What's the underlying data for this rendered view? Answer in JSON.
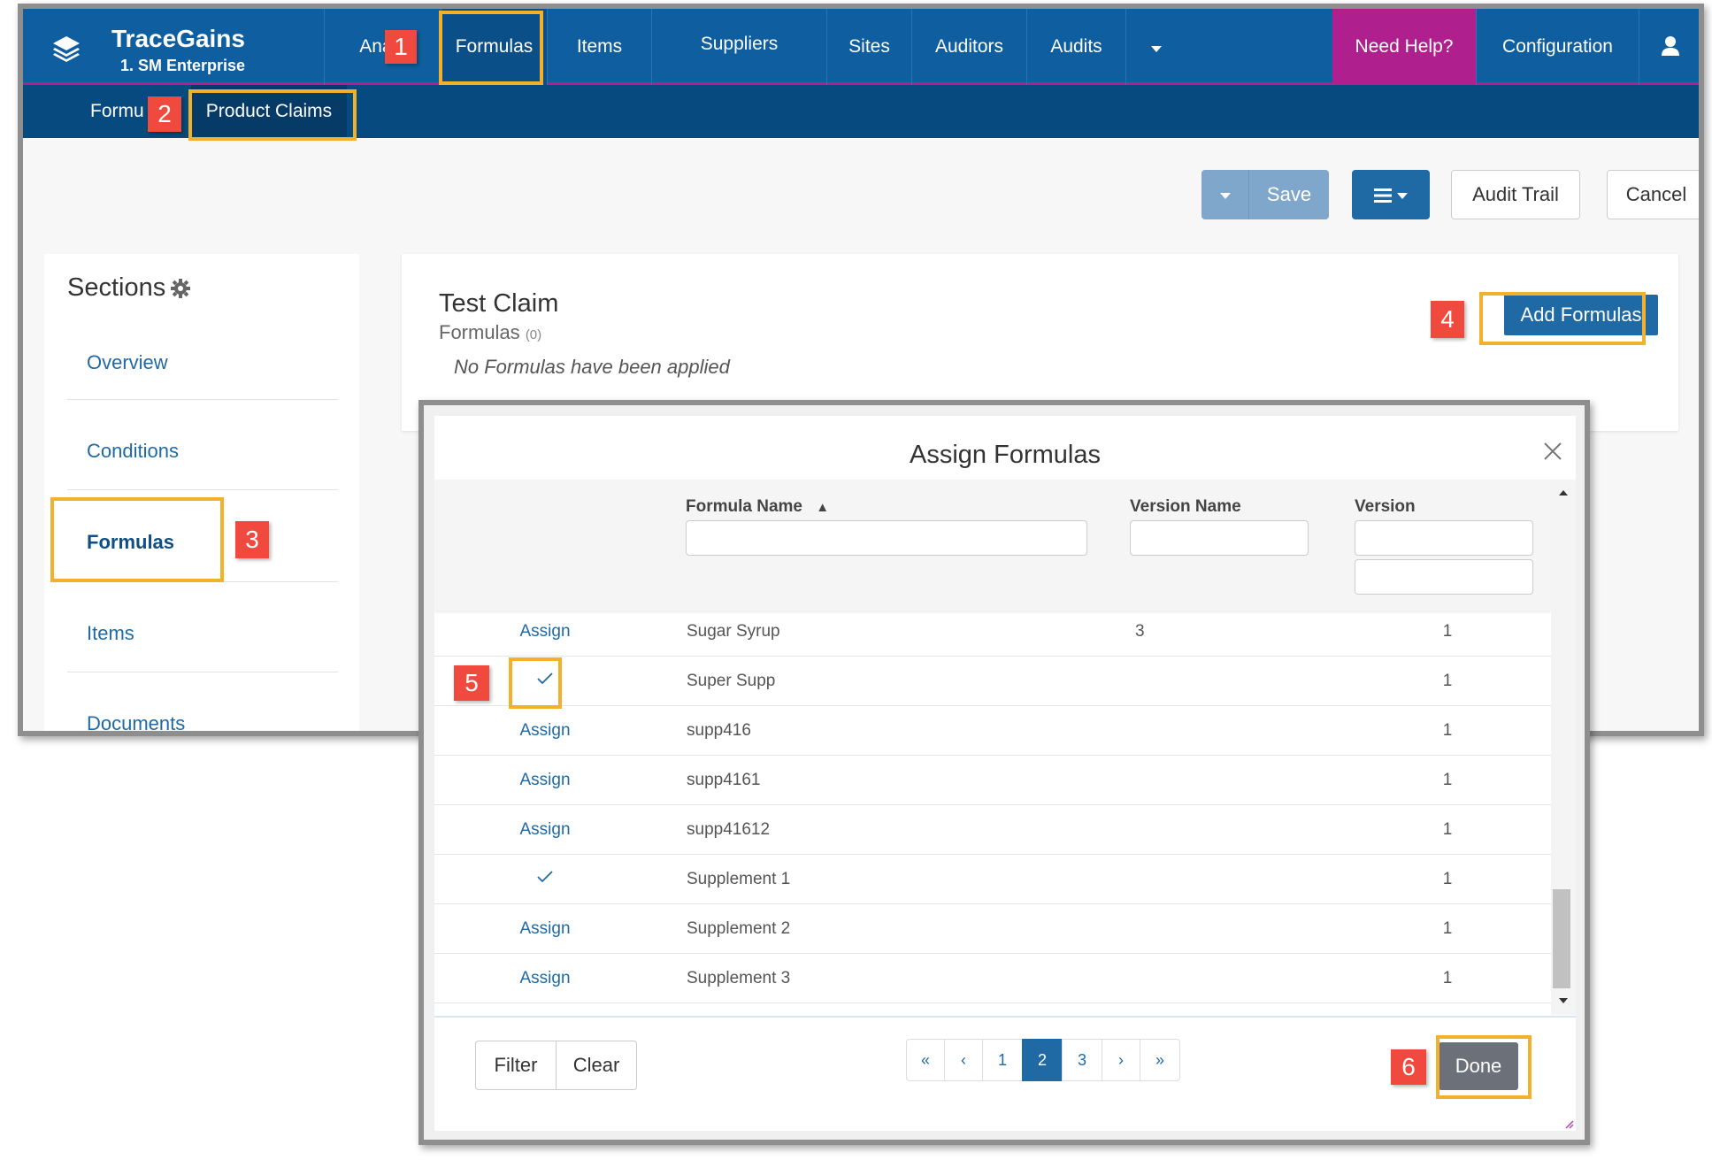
{
  "app": {
    "brand_name": "TraceGains",
    "brand_sub": "1. SM Enterprise",
    "nav": [
      "Analytics",
      "Formulas",
      "Items",
      "Suppliers",
      "Sites",
      "Auditors",
      "Audits"
    ],
    "nav_visible_analytics": "Analy",
    "need_help": "Need Help?",
    "configuration": "Configuration",
    "subnav": [
      "Formu",
      "Product Claims"
    ],
    "accent_color": "#0f5fa0",
    "help_color": "#b01f8e"
  },
  "toolbar": {
    "save": "Save",
    "audit_trail": "Audit Trail",
    "cancel": "Cancel"
  },
  "sections": {
    "title": "Sections",
    "items": [
      "Overview",
      "Conditions",
      "Formulas",
      "Items",
      "Documents"
    ]
  },
  "claim": {
    "title": "Test Claim",
    "subtitle": "Formulas",
    "count": "(0)",
    "empty": "No Formulas have been applied",
    "add_button": "Add Formulas"
  },
  "modal": {
    "title": "Assign Formulas",
    "columns": [
      "Formula Name",
      "Version Name",
      "Version"
    ],
    "sort_indicator": "▲",
    "rows": [
      {
        "action": "Assign",
        "name": "Sugar Syrup",
        "version_name": "3",
        "version": "1"
      },
      {
        "action": "check",
        "name": "Super Supp",
        "version_name": "",
        "version": "1"
      },
      {
        "action": "Assign",
        "name": "supp416",
        "version_name": "",
        "version": "1"
      },
      {
        "action": "Assign",
        "name": "supp4161",
        "version_name": "",
        "version": "1"
      },
      {
        "action": "Assign",
        "name": "supp41612",
        "version_name": "",
        "version": "1"
      },
      {
        "action": "check",
        "name": "Supplement 1",
        "version_name": "",
        "version": "1"
      },
      {
        "action": "Assign",
        "name": "Supplement 2",
        "version_name": "",
        "version": "1"
      },
      {
        "action": "Assign",
        "name": "Supplement 3",
        "version_name": "",
        "version": "1"
      }
    ],
    "filter": "Filter",
    "clear": "Clear",
    "pagination": [
      "«",
      "‹",
      "1",
      "2",
      "3",
      "›",
      "»"
    ],
    "current_page": "2",
    "done": "Done"
  },
  "markers": [
    "1",
    "2",
    "3",
    "4",
    "5",
    "6"
  ]
}
